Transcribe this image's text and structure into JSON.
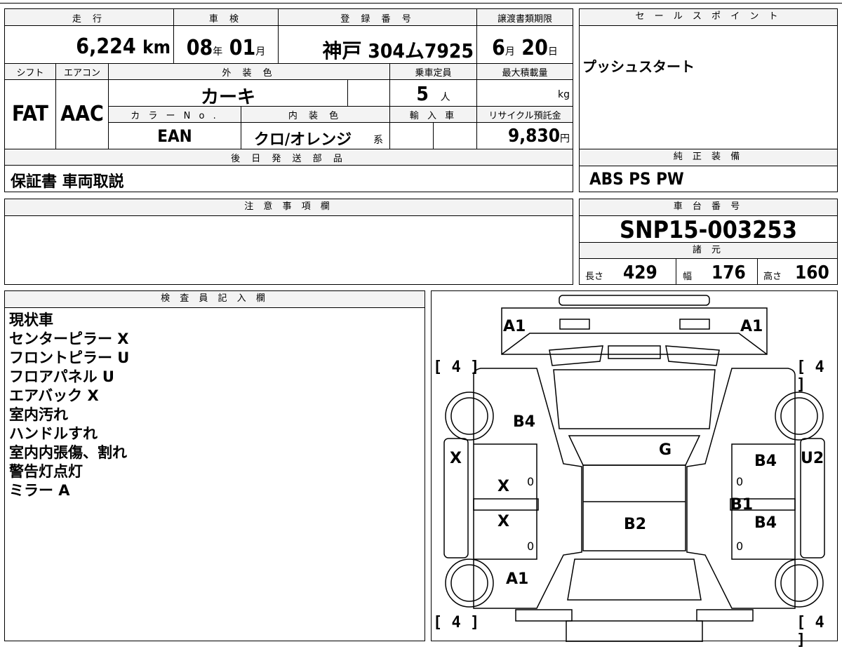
{
  "summary": {
    "headers": {
      "mileage": "走 行",
      "inspection": "車 検",
      "registration": "登 録 番 号",
      "transfer_deadline": "譲渡書類期限",
      "shift": "シフト",
      "aircon": "エアコン",
      "exterior_color": "外 装 色",
      "capacity": "乗車定員",
      "max_load": "最大積載量",
      "color_no": "カ ラ ー N o .",
      "interior_color": "内 装 色",
      "import": "輸 入 車",
      "recycle_fee": "リサイクル預託金",
      "later_parts": "後 日 発 送 部 品"
    },
    "mileage_value": "6,224",
    "mileage_unit": "km",
    "inspection_year": "08",
    "inspection_year_unit": "年",
    "inspection_month": "01",
    "inspection_month_unit": "月",
    "registration_number": "神戸 304ム7925",
    "deadline_month": "6",
    "deadline_month_unit": "月",
    "deadline_day": "20",
    "deadline_day_unit": "日",
    "shift_value": "FAT",
    "aircon_value": "AAC",
    "exterior_color_value": "カーキ",
    "capacity_value": "5",
    "capacity_unit": "人",
    "max_load_unit": "kg",
    "color_no_value": "EAN",
    "interior_color_value": "クロ/オレンジ",
    "interior_color_suffix": "系",
    "recycle_fee_value": "9,830",
    "recycle_fee_unit": "円",
    "later_parts_value": "保証書 車両取説"
  },
  "sales_point": {
    "header": "セ ー ル ス ポ イ ン ト",
    "value": "プッシュスタート"
  },
  "equipment": {
    "header": "純 正 装 備",
    "value": "ABS PS PW"
  },
  "notes": {
    "header": "注 意 事 項 欄",
    "value": ""
  },
  "chassis": {
    "header": "車 台 番 号",
    "value": "SNP15-003253"
  },
  "specs": {
    "header": "諸 元",
    "length_label": "長さ",
    "length_value": "429",
    "width_label": "幅",
    "width_value": "176",
    "height_label": "高さ",
    "height_value": "160"
  },
  "inspector": {
    "header": "検 査 員 記 入 欄",
    "remarks": [
      "現状車",
      "センターピラー X",
      "フロントピラー U",
      "フロアパネル U",
      "エアバック X",
      "室内汚れ",
      "ハンドルすれ",
      "室内内張傷、割れ",
      "警告灯点灯",
      "ミラー A"
    ]
  },
  "diagram": {
    "labels": {
      "front_left": "A1",
      "front_right": "A1",
      "bracket_fl": "[ 4 ]",
      "bracket_fr": "[ 4 ]",
      "bracket_rl": "[ 4 ]",
      "bracket_rr": "[ 4 ]",
      "hood_left": "B4",
      "roof": "G",
      "left_side": "X",
      "right_side": "U2",
      "left_front_door": "X",
      "left_rear_door": "X",
      "right_front_door": "B4",
      "right_center": "B1",
      "right_rear_door": "B4",
      "center": "B2",
      "rear_left": "A1",
      "zero_1": "0",
      "zero_2": "0",
      "zero_3": "0",
      "zero_4": "0"
    }
  }
}
